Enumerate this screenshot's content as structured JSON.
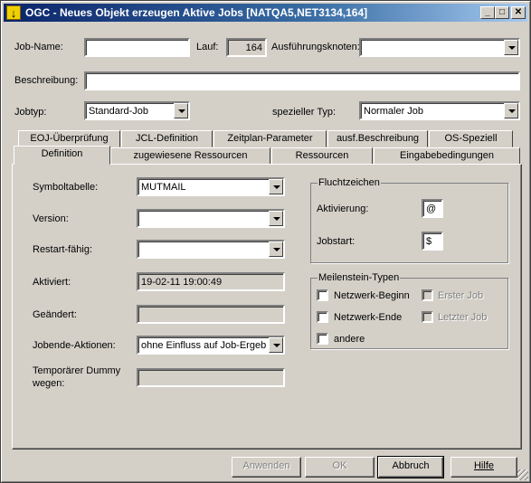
{
  "window": {
    "title": "OGC - Neues Objekt erzeugen Aktive Jobs [NATQA5,NET3134,164]",
    "icon": "app-icon",
    "minimize_glyph": "_",
    "maximize_glyph": "□",
    "close_glyph": "✕"
  },
  "header": {
    "job_name_label": "Job-Name:",
    "job_name_value": "",
    "lauf_label": "Lauf:",
    "lauf_value": "164",
    "node_label": "Ausführungsknoten:",
    "node_value": "",
    "description_label": "Beschreibung:",
    "description_value": "",
    "jobtype_label": "Jobtyp:",
    "jobtype_value": "Standard-Job",
    "special_type_label": "spezieller Typ:",
    "special_type_value": "Normaler Job"
  },
  "tabs_row1": [
    "EOJ-Überprüfung",
    "JCL-Definition",
    "Zeitplan-Parameter",
    "ausf.Beschreibung",
    "OS-Speziell"
  ],
  "tabs_row2": [
    "Definition",
    "zugewiesene Ressourcen",
    "Ressourcen",
    "Eingabebedingungen"
  ],
  "active_tab": "Definition",
  "definition": {
    "symboltable_label": "Symboltabelle:",
    "symboltable_value": "MUTMAIL",
    "version_label": "Version:",
    "version_value": "",
    "restart_label": "Restart-fähig:",
    "restart_value": "",
    "activated_label": "Aktiviert:",
    "activated_value": "19-02-11 19:00:49",
    "changed_label": "Geändert:",
    "changed_value": "",
    "jobend_label": "Jobende-Aktionen:",
    "jobend_value": "ohne Einfluss auf Job-Ergebnis",
    "dummy_label_1": "Temporärer Dummy",
    "dummy_label_2": "wegen:",
    "dummy_value": ""
  },
  "escape": {
    "title": "Fluchtzeichen",
    "activation_label": "Aktivierung:",
    "activation_value": "@",
    "jobstart_label": "Jobstart:",
    "jobstart_value": "$"
  },
  "milestones": {
    "title": "Meilenstein-Typen",
    "network_begin": "Netzwerk-Beginn",
    "network_end": "Netzwerk-Ende",
    "other": "andere",
    "first_job": "Erster Job",
    "last_job": "Letzter Job"
  },
  "buttons": {
    "apply": "Anwenden",
    "ok": "OK",
    "cancel": "Abbruch",
    "help": "Hilfe"
  }
}
